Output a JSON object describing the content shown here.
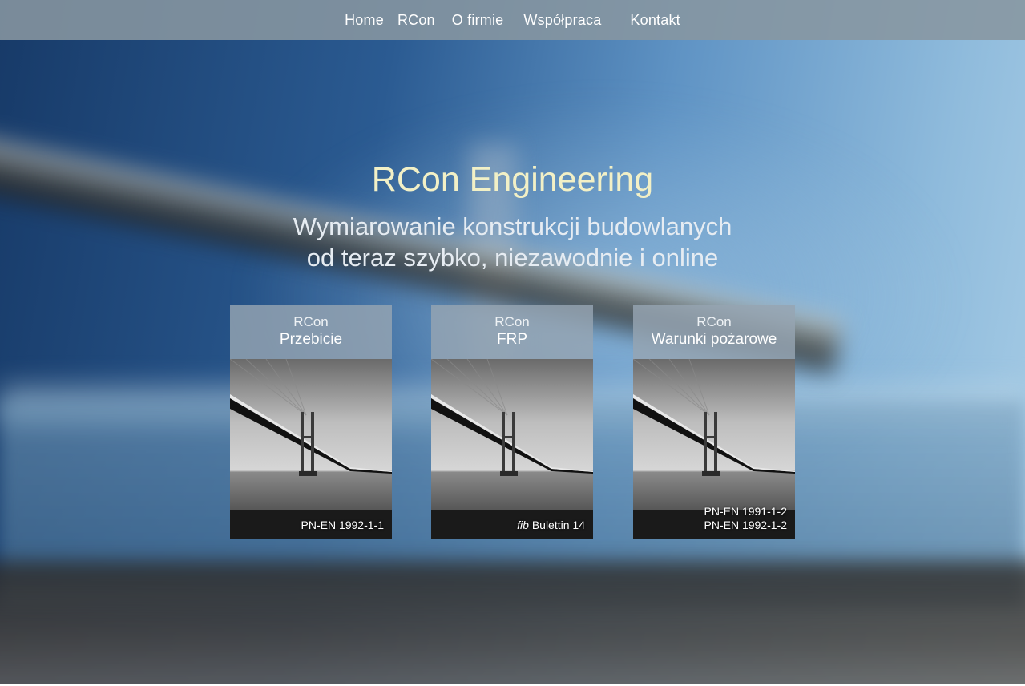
{
  "nav": {
    "items": [
      {
        "label": "Home"
      },
      {
        "label": "RCon"
      },
      {
        "label": "O firmie"
      },
      {
        "label": "Współpraca"
      },
      {
        "label": "Kontakt"
      }
    ]
  },
  "hero": {
    "title": "RCon Engineering",
    "subtitle_line1": "Wymiarowanie konstrukcji budowlanych",
    "subtitle_line2": "od teraz szybko, niezawodnie i online"
  },
  "cards": [
    {
      "brand": "RCon",
      "name": "Przebicie",
      "code_lines": [
        "PN-EN 1992-1-1"
      ]
    },
    {
      "brand": "RCon",
      "name": "FRP",
      "code_prefix": "fib",
      "code_suffix": " Bulettin 14"
    },
    {
      "brand": "RCon",
      "name": "Warunki pożarowe",
      "code_lines": [
        "PN-EN 1991-1-2",
        "PN-EN 1992-1-2"
      ]
    }
  ],
  "colors": {
    "title": "#f2f0c6",
    "nav_bar": "#87969f",
    "card_header": "#96a5b2"
  }
}
